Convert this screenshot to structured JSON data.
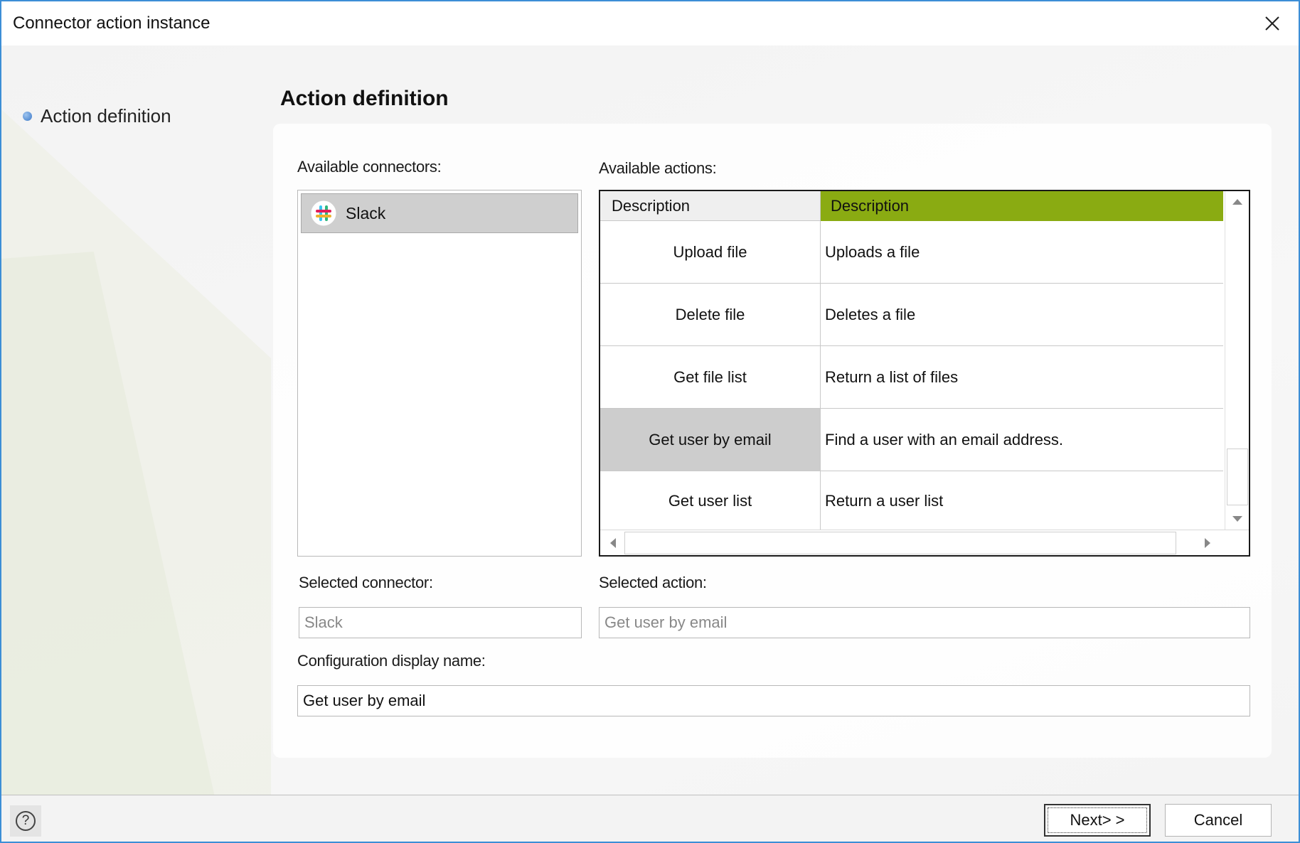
{
  "window": {
    "title": "Connector action instance"
  },
  "steps": [
    {
      "label": "Action definition"
    }
  ],
  "main": {
    "heading": "Action definition",
    "connectors": {
      "label": "Available connectors:",
      "items": [
        {
          "label": "Slack",
          "icon": "slack-logo",
          "selected": true
        }
      ]
    },
    "actions": {
      "label": "Available actions:",
      "columns": [
        "Description",
        "Description"
      ],
      "header_accent": "#8aab12",
      "rows": [
        {
          "name": "Upload file",
          "description": "Uploads a file"
        },
        {
          "name": "Delete file",
          "description": "Deletes a file"
        },
        {
          "name": "Get file list",
          "description": "Return a list of files"
        },
        {
          "name": "Get user by email",
          "description": "Find a user with an email address.",
          "selected": true
        },
        {
          "name": "Get user list",
          "description": "Return a user list"
        }
      ]
    },
    "selected_connector": {
      "label": "Selected connector:",
      "value": "Slack"
    },
    "selected_action": {
      "label": "Selected action:",
      "value": "Get user by email"
    },
    "display_name": {
      "label": "Configuration display name:",
      "value": "Get user by email"
    }
  },
  "footer": {
    "help_icon": "help-icon",
    "help_glyph": "?",
    "next_label": "Next> >",
    "cancel_label": "Cancel"
  }
}
